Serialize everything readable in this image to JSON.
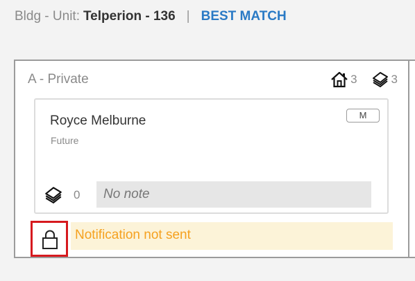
{
  "header": {
    "label": "Bldg - Unit:",
    "value": "Telperion - 136",
    "separator": "|",
    "link": "BEST MATCH",
    "link_color": "#2a7ac5"
  },
  "room": {
    "title": "A - Private",
    "stats": {
      "house_icon": "house-icon",
      "house_count": "3",
      "notes_icon": "notes-stack-icon",
      "notes_count": "3"
    },
    "tenant": {
      "name": "Royce Melburne",
      "status": "Future",
      "gender_badge": "M",
      "note_icon": "notes-stack-icon",
      "note_count": "0",
      "note_placeholder": "No note"
    },
    "notification": {
      "icon": "lock-icon",
      "text": "Notification not sent",
      "text_color": "#f5a11f",
      "background": "#fcf3d8",
      "highlight_border": "#d6191e"
    }
  }
}
